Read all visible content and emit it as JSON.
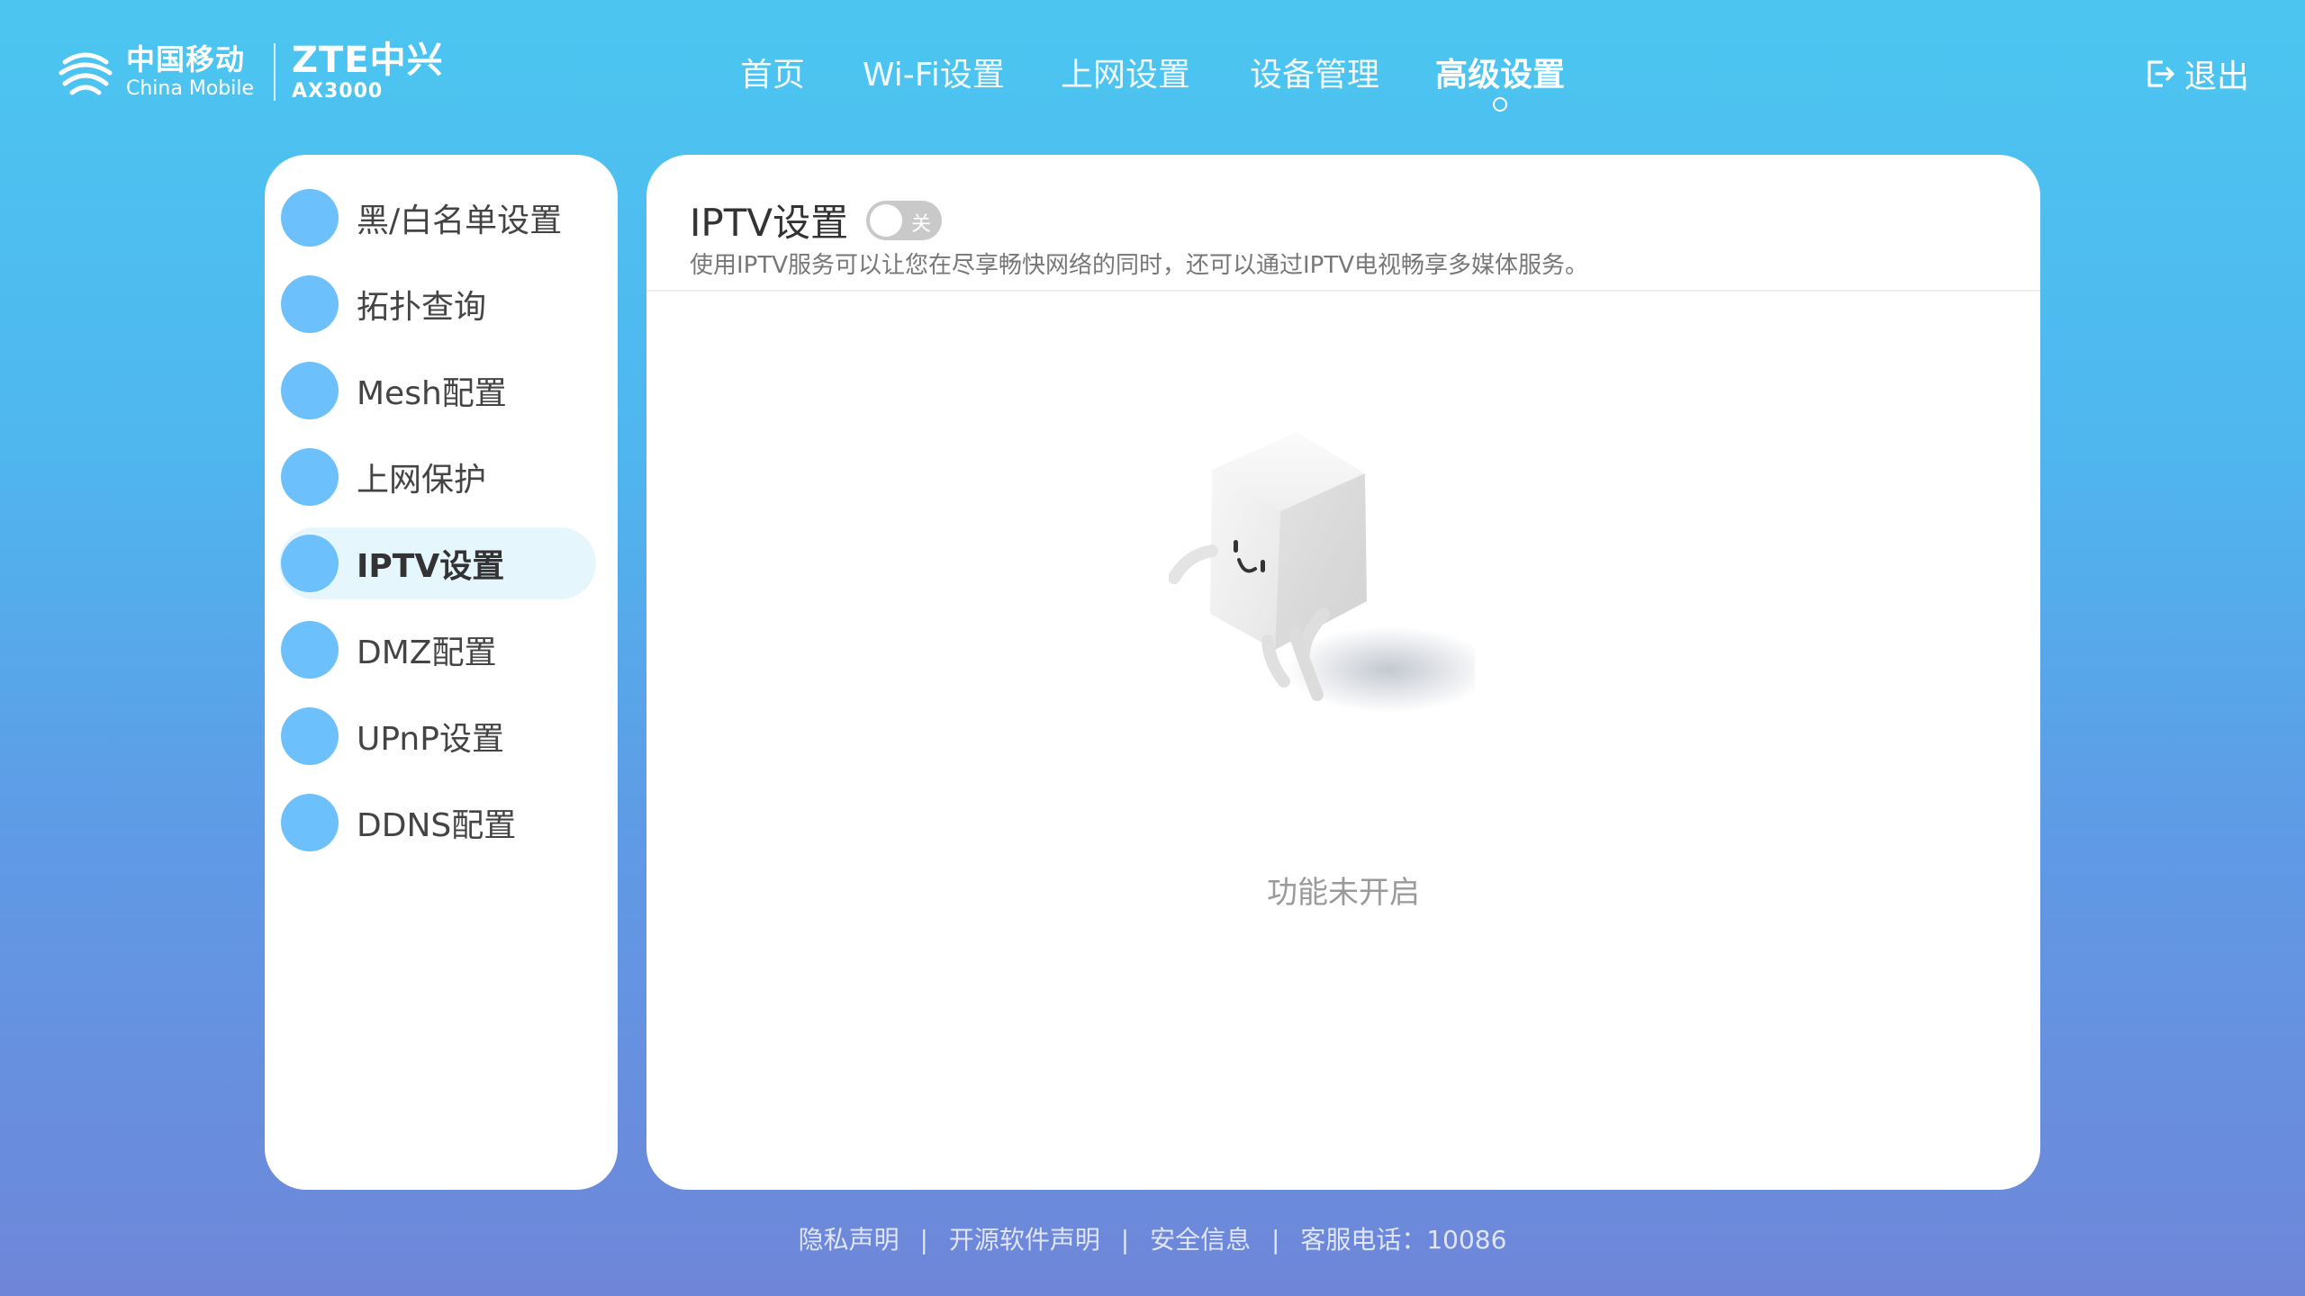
{
  "brand": {
    "china_mobile_cn": "中国移动",
    "china_mobile_en": "China Mobile",
    "zte_name": "ZTE中兴",
    "model": "AX3000"
  },
  "nav": {
    "items": [
      {
        "label": "首页"
      },
      {
        "label": "Wi-Fi设置"
      },
      {
        "label": "上网设置"
      },
      {
        "label": "设备管理"
      },
      {
        "label": "高级设置"
      }
    ],
    "active_index": 4
  },
  "logout_label": "退出",
  "sidebar": {
    "items": [
      {
        "label": "黑/白名单设置"
      },
      {
        "label": "拓扑查询"
      },
      {
        "label": "Mesh配置"
      },
      {
        "label": "上网保护"
      },
      {
        "label": "IPTV设置"
      },
      {
        "label": "DMZ配置"
      },
      {
        "label": "UPnP设置"
      },
      {
        "label": "DDNS配置"
      }
    ],
    "active_index": 4
  },
  "panel": {
    "title": "IPTV设置",
    "toggle_state": "关",
    "description": "使用IPTV服务可以让您在尽享畅快网络的同时，还可以通过IPTV电视畅享多媒体服务。",
    "empty_text": "功能未开启"
  },
  "footer": {
    "links": [
      "隐私声明",
      "开源软件声明",
      "安全信息"
    ],
    "hotline": "客服电话：10086"
  },
  "colors": {
    "bg_top": "#4cc6f1",
    "bg_bottom": "#6f86d8",
    "accent": "#6cc0fb",
    "active_bg": "#e6f6fd"
  }
}
